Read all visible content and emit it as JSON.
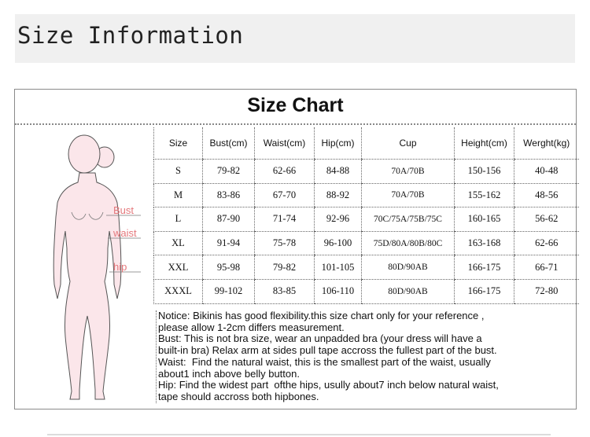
{
  "banner": {
    "title": "Size Information"
  },
  "chart": {
    "title": "Size Chart",
    "labels": {
      "bust": "Bust",
      "waist": "waist",
      "hip": "hip"
    },
    "headers": [
      "Size",
      "Bust(cm)",
      "Waist(cm)",
      "Hip(cm)",
      "Cup",
      "Height(cm)",
      "Werght(kg)"
    ],
    "rows": [
      [
        "S",
        "79-82",
        "62-66",
        "84-88",
        "70A/70B",
        "150-156",
        "40-48"
      ],
      [
        "M",
        "83-86",
        "67-70",
        "88-92",
        "70A/70B",
        "155-162",
        "48-56"
      ],
      [
        "L",
        "87-90",
        "71-74",
        "92-96",
        "70C/75A/75B/75C",
        "160-165",
        "56-62"
      ],
      [
        "XL",
        "91-94",
        "75-78",
        "96-100",
        "75D/80A/80B/80C",
        "163-168",
        "62-66"
      ],
      [
        "XXL",
        "95-98",
        "79-82",
        "101-105",
        "80D/90AB",
        "166-175",
        "66-71"
      ],
      [
        "XXXL",
        "99-102",
        "83-85",
        "106-110",
        "80D/90AB",
        "166-175",
        "72-80"
      ]
    ],
    "notes": [
      "Notice: Bikinis has good flexibility.this size chart only for your reference ,",
      "please allow 1-2cm differs measurement.",
      "Bust: This is not bra size, wear an unpadded bra (your dress will have a",
      "built-in bra) Relax arm at sides pull tape accross the fullest part of the bust.",
      "Waist:  Find the natural waist, this is the smallest part of the waist, usually",
      "about1 inch above belly button.",
      "Hip: Find the widest part  ofthe hips, usully about7 inch below natural waist,",
      "tape should accross both hipbones."
    ]
  }
}
